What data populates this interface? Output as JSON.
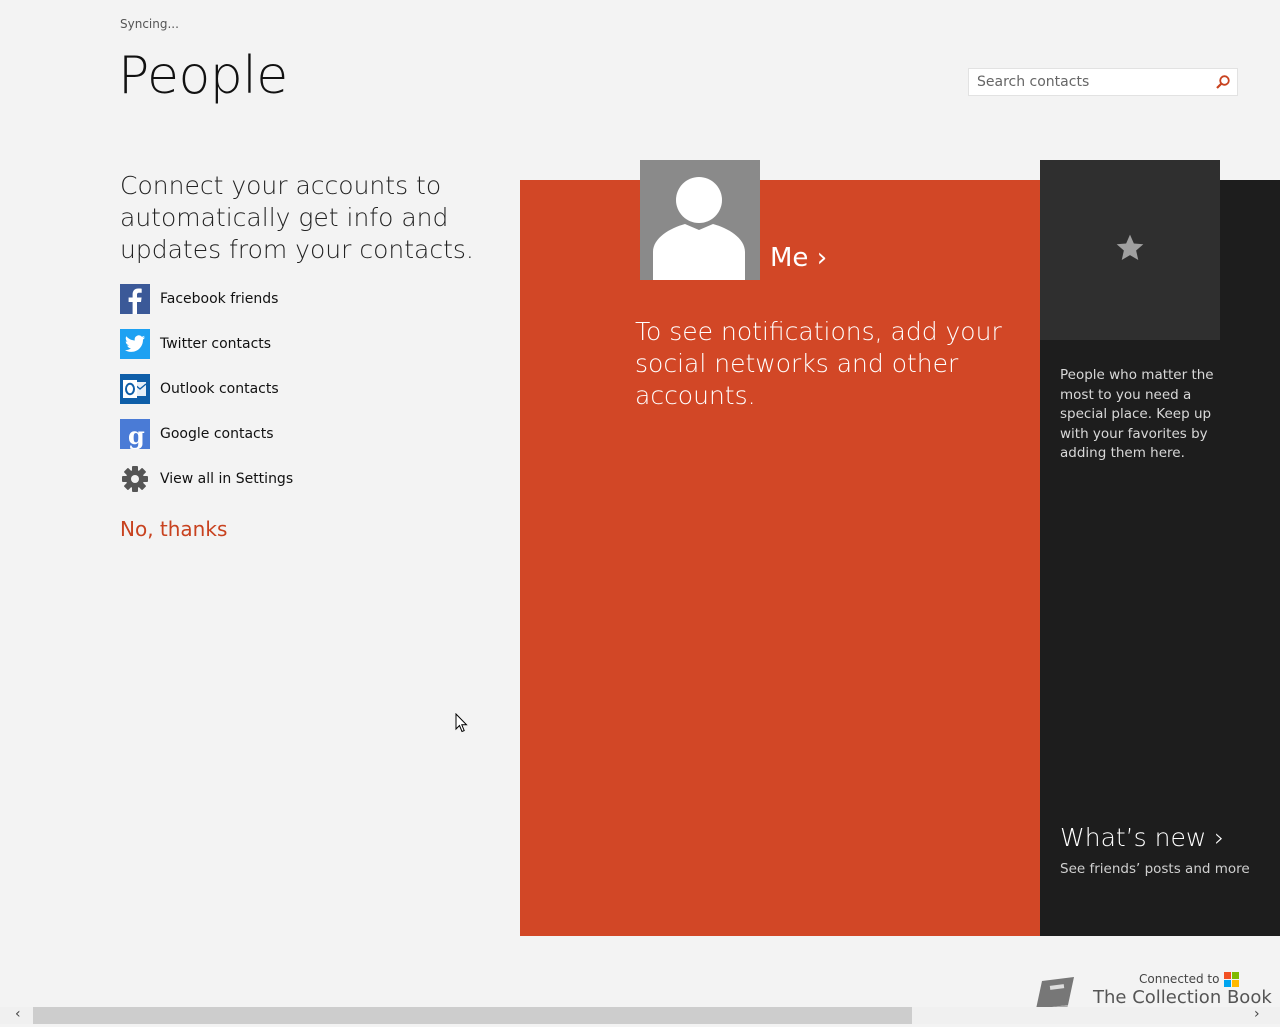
{
  "app": {
    "status": "Syncing...",
    "title": "People"
  },
  "search": {
    "placeholder": "Search contacts",
    "value": ""
  },
  "connect_panel": {
    "heading": "Connect your accounts to automatically get info and updates from your contacts.",
    "accounts": [
      {
        "label": "Facebook friends",
        "icon": "facebook-icon",
        "color": "#3b5998"
      },
      {
        "label": "Twitter contacts",
        "icon": "twitter-icon",
        "color": "#1da1f2"
      },
      {
        "label": "Outlook contacts",
        "icon": "outlook-icon",
        "color": "#0f5ea8"
      },
      {
        "label": "Google contacts",
        "icon": "google-icon",
        "color": "#4a7bd6"
      }
    ],
    "settings_label": "View all in Settings",
    "dismiss_label": "No, thanks"
  },
  "me_tile": {
    "label": "Me",
    "chevron": "›",
    "notification_text": "To see notifications, add your social networks and other accounts.",
    "color": "#d24726"
  },
  "favorites": {
    "icon": "star-icon",
    "text": "People who matter the most to you need a special place. Keep up with your favorites by adding them here."
  },
  "whats_new": {
    "title": "What’s new",
    "chevron": "›",
    "subtitle": "See friends’ posts and more"
  },
  "footer": {
    "connected_to": "Connected to",
    "collection_name": "The Collection Book"
  },
  "scrollbar": {
    "left_arrow": "‹",
    "right_arrow": "›"
  }
}
